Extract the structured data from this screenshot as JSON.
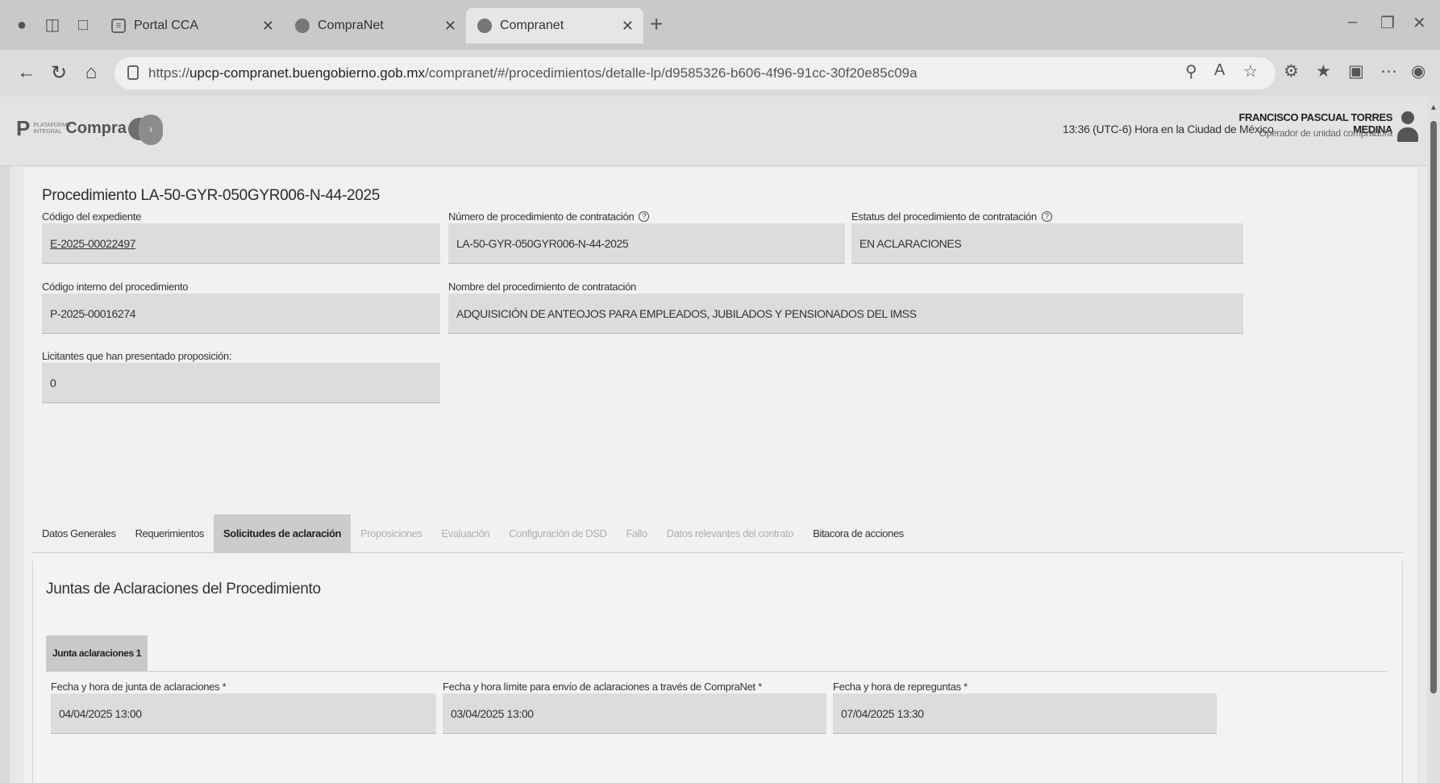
{
  "browser": {
    "tabs": [
      {
        "label": "Portal CCA"
      },
      {
        "label": "CompraNet"
      },
      {
        "label": "Compranet"
      }
    ],
    "url_prefix": "https://",
    "url_host": "upcp-compranet.buengobierno.gob.mx",
    "url_path": "/compranet/#/procedimientos/detalle-lp/d9585326-b606-4f96-91cc-30f20e85c09a"
  },
  "header": {
    "logo_prefix": "P",
    "logo_small": "PLATAFORMA INTEGRAL",
    "logo_name": "Compra",
    "timezone": "13:36 (UTC-6) Hora en la Ciudad de México",
    "user_name": "FRANCISCO PASCUAL TORRES MEDINA",
    "user_role": "Operador de unidad compradora"
  },
  "procedure": {
    "title": "Procedimiento LA-50-GYR-050GYR006-N-44-2025",
    "fields": {
      "codigo_expediente": {
        "label": "Código del expediente",
        "value": "E-2025-00022497"
      },
      "numero_procedimiento": {
        "label": "Número de procedimiento de contratación",
        "value": "LA-50-GYR-050GYR006-N-44-2025"
      },
      "estatus": {
        "label": "Estatus del procedimiento de contratación",
        "value": "EN ACLARACIONES"
      },
      "codigo_interno": {
        "label": "Código interno del procedimiento",
        "value": "P-2025-00016274"
      },
      "nombre": {
        "label": "Nombre del procedimiento de contratación",
        "value": "ADQUISICIÓN DE ANTEOJOS PARA EMPLEADOS, JUBILADOS Y PENSIONADOS DEL IMSS"
      },
      "licitantes": {
        "label": "Licitantes que han presentado proposición:",
        "value": "0"
      }
    }
  },
  "tabs": [
    {
      "label": "Datos Generales",
      "state": "normal"
    },
    {
      "label": "Requerimientos",
      "state": "normal"
    },
    {
      "label": "Solicitudes de aclaración",
      "state": "active"
    },
    {
      "label": "Proposiciones",
      "state": "disabled"
    },
    {
      "label": "Evaluación",
      "state": "disabled"
    },
    {
      "label": "Configuración de DSD",
      "state": "disabled"
    },
    {
      "label": "Fallo",
      "state": "disabled"
    },
    {
      "label": "Datos relevantes del contrato",
      "state": "disabled"
    },
    {
      "label": "Bitacora de acciones",
      "state": "normal"
    }
  ],
  "juntas": {
    "title": "Juntas de Aclaraciones del Procedimiento",
    "tab_label": "Junta aclaraciones 1",
    "fields": {
      "fecha_junta": {
        "label": "Fecha y hora de junta de aclaraciones *",
        "value": "04/04/2025 13:00"
      },
      "fecha_limite": {
        "label": "Fecha y hora límite para envío de aclaraciones a través de CompraNet *",
        "value": "03/04/2025 13:00"
      },
      "fecha_repreguntas": {
        "label": "Fecha y hora de repreguntas *",
        "value": "07/04/2025 13:30"
      }
    }
  }
}
